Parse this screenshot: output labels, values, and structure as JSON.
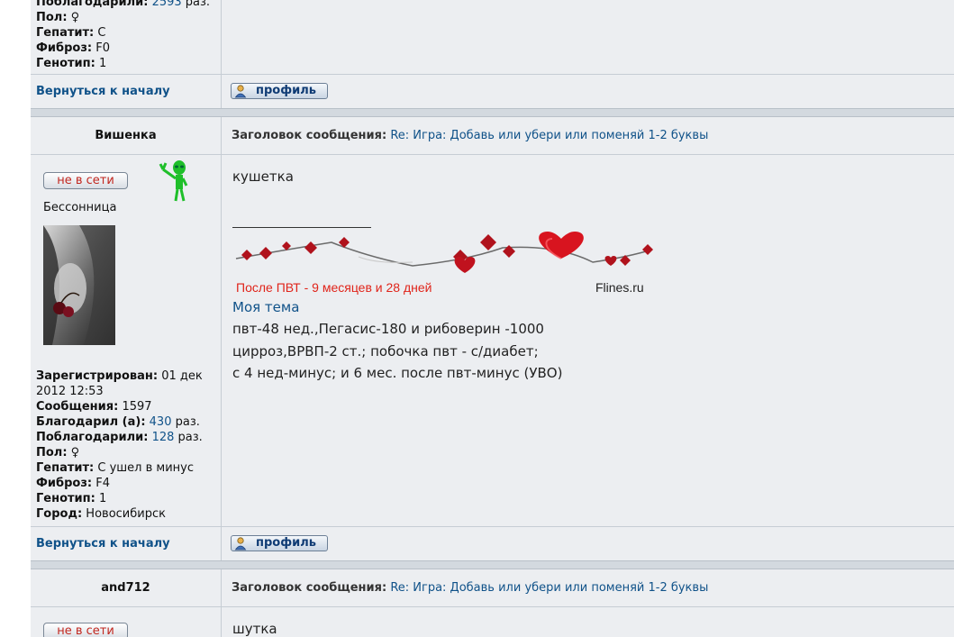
{
  "post_top": {
    "profile_partial": [
      {
        "label": "Поблагодарили:",
        "value": "2593",
        "suffix": " раз."
      },
      {
        "label": "Пол:",
        "value": "♀"
      },
      {
        "label": "Гепатит:",
        "value": "C"
      },
      {
        "label": "Фиброз:",
        "value": "F0"
      },
      {
        "label": "Генотип:",
        "value": "1"
      }
    ],
    "back_to_top": "Вернуться к началу",
    "profile_button": "профиль"
  },
  "post_vishenka": {
    "author": "Вишенка",
    "subject_label": "Заголовок сообщения:",
    "subject_value": "Re: Игра: Добавь или убери или поменяй 1-2 буквы",
    "status": "не в сети",
    "rank": "Бессонница",
    "profile": {
      "registered_label": "Зарегистрирован:",
      "registered_value_1": "01 дек",
      "registered_value_2": "2012 12:53",
      "posts_label": "Сообщения:",
      "posts_value": "1597",
      "thanked_label": "Благодарил (а):",
      "thanked_value": "430",
      "thanked_suffix": " раз.",
      "got_thanks_label": "Поблагодарили:",
      "got_thanks_value": "128",
      "got_thanks_suffix": " раз.",
      "gender_label": "Пол:",
      "gender_value": "♀",
      "hepatitis_label": "Гепатит:",
      "hepatitis_value": "C ушел в минус",
      "fibrosis_label": "Фиброз:",
      "fibrosis_value": "F4",
      "genotype_label": "Генотип:",
      "genotype_value": "1",
      "city_label": "Город:",
      "city_value": "Новосибирск"
    },
    "message": "кушетка",
    "signature": {
      "ptv_counter": "После ПВТ -  9 месяцев и 28 дней",
      "flines": "Flines.ru",
      "my_topic": "Моя тема",
      "line1": "пвт-48 нед.,Пегасис-180 и рибоверин -1000",
      "line2": "цирроз,ВРВП-2 ст.; побочка пвт - с/диабет;",
      "line3": "с 4 нед-минус; и 6 мес. после пвт-минус (УВО)"
    },
    "back_to_top": "Вернуться к началу",
    "profile_button": "профиль"
  },
  "post_and712": {
    "author": "and712",
    "subject_label": "Заголовок сообщения:",
    "subject_value": "Re: Игра: Добавь или убери или поменяй 1-2 буквы",
    "status": "не в сети",
    "message": "шутка"
  },
  "colors": {
    "link": "#105289",
    "offline": "#c1261e",
    "ptv_red": "#e0241a"
  }
}
